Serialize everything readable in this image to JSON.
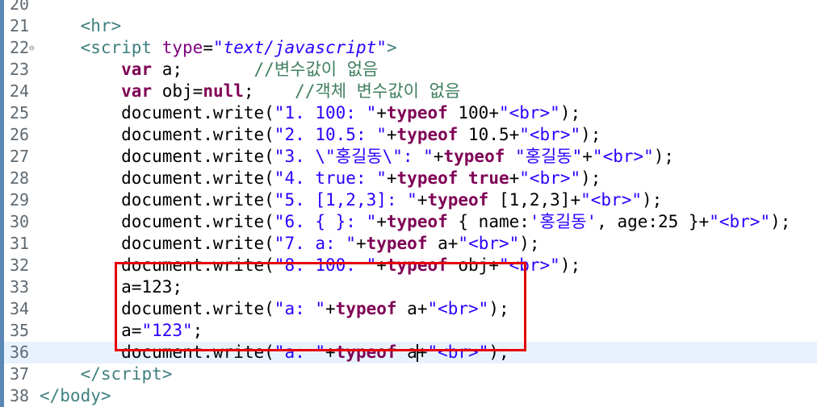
{
  "lines": [
    {
      "n": "20",
      "parts": []
    },
    {
      "n": "21",
      "parts": [
        [
          "pl",
          "    "
        ],
        [
          "tag",
          "<hr>"
        ]
      ]
    },
    {
      "n": "22",
      "fold": "⊖",
      "parts": [
        [
          "pl",
          "    "
        ],
        [
          "tag",
          "<script "
        ],
        [
          "attr",
          "type"
        ],
        [
          "pl",
          "="
        ],
        [
          "attrval",
          "\"text/javascript\""
        ],
        [
          "tag",
          ">"
        ]
      ]
    },
    {
      "n": "23",
      "parts": [
        [
          "pl",
          "        "
        ],
        [
          "kw",
          "var"
        ],
        [
          "pl",
          " a;       "
        ],
        [
          "cmt",
          "//변수값이 없음"
        ]
      ]
    },
    {
      "n": "24",
      "parts": [
        [
          "pl",
          "        "
        ],
        [
          "kw",
          "var"
        ],
        [
          "pl",
          " obj="
        ],
        [
          "kw",
          "null"
        ],
        [
          "pl",
          ";    "
        ],
        [
          "cmt",
          "//객체 변수값이 없음"
        ]
      ]
    },
    {
      "n": "25",
      "parts": [
        [
          "pl",
          "        document.write("
        ],
        [
          "str",
          "\"1. 100: \""
        ],
        [
          "pl",
          "+"
        ],
        [
          "kw",
          "typeof"
        ],
        [
          "pl",
          " 100+"
        ],
        [
          "str",
          "\"<br>\""
        ],
        [
          "pl",
          ");"
        ]
      ]
    },
    {
      "n": "26",
      "parts": [
        [
          "pl",
          "        document.write("
        ],
        [
          "str",
          "\"2. 10.5: \""
        ],
        [
          "pl",
          "+"
        ],
        [
          "kw",
          "typeof"
        ],
        [
          "pl",
          " 10.5+"
        ],
        [
          "str",
          "\"<br>\""
        ],
        [
          "pl",
          ");"
        ]
      ]
    },
    {
      "n": "27",
      "parts": [
        [
          "pl",
          "        document.write("
        ],
        [
          "str",
          "\"3. \\\"홍길동\\\": \""
        ],
        [
          "pl",
          "+"
        ],
        [
          "kw",
          "typeof"
        ],
        [
          "pl",
          " "
        ],
        [
          "str",
          "\"홍길동\""
        ],
        [
          "pl",
          "+"
        ],
        [
          "str",
          "\"<br>\""
        ],
        [
          "pl",
          ");"
        ]
      ]
    },
    {
      "n": "28",
      "parts": [
        [
          "pl",
          "        document.write("
        ],
        [
          "str",
          "\"4. true: \""
        ],
        [
          "pl",
          "+"
        ],
        [
          "kw",
          "typeof"
        ],
        [
          "pl",
          " "
        ],
        [
          "kw",
          "true"
        ],
        [
          "pl",
          "+"
        ],
        [
          "str",
          "\"<br>\""
        ],
        [
          "pl",
          ");"
        ]
      ]
    },
    {
      "n": "29",
      "parts": [
        [
          "pl",
          "        document.write("
        ],
        [
          "str",
          "\"5. [1,2,3]: \""
        ],
        [
          "pl",
          "+"
        ],
        [
          "kw",
          "typeof"
        ],
        [
          "pl",
          " [1,2,3]+"
        ],
        [
          "str",
          "\"<br>\""
        ],
        [
          "pl",
          ");"
        ]
      ]
    },
    {
      "n": "30",
      "parts": [
        [
          "pl",
          "        document.write("
        ],
        [
          "str",
          "\"6. { }: \""
        ],
        [
          "pl",
          "+"
        ],
        [
          "kw",
          "typeof"
        ],
        [
          "pl",
          " { name:"
        ],
        [
          "str",
          "'홍길동'"
        ],
        [
          "pl",
          ", age:25 }+"
        ],
        [
          "str",
          "\"<br>\""
        ],
        [
          "pl",
          ");"
        ]
      ]
    },
    {
      "n": "31",
      "parts": [
        [
          "pl",
          "        document.write("
        ],
        [
          "str",
          "\"7. a: \""
        ],
        [
          "pl",
          "+"
        ],
        [
          "kw",
          "typeof"
        ],
        [
          "pl",
          " a+"
        ],
        [
          "str",
          "\"<br>\""
        ],
        [
          "pl",
          ");"
        ]
      ]
    },
    {
      "n": "32",
      "parts": [
        [
          "pl",
          "        document.write("
        ],
        [
          "str",
          "\"8. 100: \""
        ],
        [
          "pl",
          "+"
        ],
        [
          "kw",
          "typeof"
        ],
        [
          "pl",
          " obj+"
        ],
        [
          "str",
          "\"<br>\""
        ],
        [
          "pl",
          ");"
        ]
      ]
    },
    {
      "n": "33",
      "parts": [
        [
          "pl",
          "        a=123;"
        ]
      ]
    },
    {
      "n": "34",
      "parts": [
        [
          "pl",
          "        document.write("
        ],
        [
          "str",
          "\"a: \""
        ],
        [
          "pl",
          "+"
        ],
        [
          "kw",
          "typeof"
        ],
        [
          "pl",
          " a+"
        ],
        [
          "str",
          "\"<br>\""
        ],
        [
          "pl",
          ");"
        ]
      ]
    },
    {
      "n": "35",
      "parts": [
        [
          "pl",
          "        a="
        ],
        [
          "str",
          "\"123\""
        ],
        [
          "pl",
          ";"
        ]
      ]
    },
    {
      "n": "36",
      "current": true,
      "parts": [
        [
          "pl",
          "        document.write("
        ],
        [
          "str",
          "\"a: \""
        ],
        [
          "pl",
          "+"
        ],
        [
          "kw",
          "typeof"
        ],
        [
          "pl",
          " a"
        ],
        [
          "caret",
          ""
        ],
        [
          "pl",
          "+"
        ],
        [
          "str",
          "\"<br>\""
        ],
        [
          "pl",
          ");"
        ]
      ]
    },
    {
      "n": "37",
      "parts": [
        [
          "pl",
          "    "
        ],
        [
          "tag",
          "</"
        ],
        [
          "tag",
          "script>"
        ]
      ]
    },
    {
      "n": "38",
      "parts": [
        [
          "tag",
          "</body>"
        ]
      ]
    }
  ],
  "colors": {
    "gutter_bar": "#5b87b7",
    "highlight_box": "#e60000",
    "current_line": "#e8f2fe"
  }
}
